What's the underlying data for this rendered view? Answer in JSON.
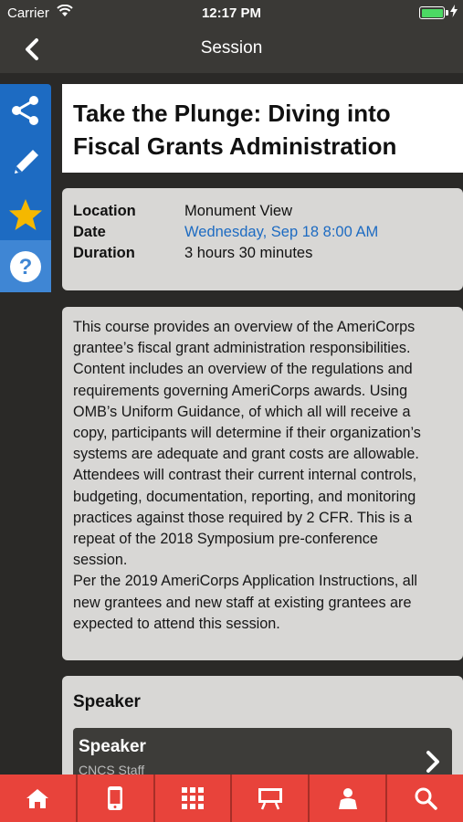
{
  "status_bar": {
    "carrier": "Carrier",
    "time": "12:17 PM",
    "battery_level": 1.0
  },
  "nav": {
    "title": "Session",
    "back_icon": "chevron-left-icon"
  },
  "side_tools": [
    {
      "icon": "share-icon"
    },
    {
      "icon": "pencil-icon"
    },
    {
      "icon": "star-icon"
    },
    {
      "icon": "help-icon"
    }
  ],
  "session": {
    "title_line1": "Take the Plunge: Diving into",
    "title_line2": "Fiscal Grants Administration",
    "location_label": "Location",
    "location_value": "Monument View",
    "date_label": "Date",
    "date_value": "Wednesday, Sep 18 8:00 AM",
    "duration_label": "Duration",
    "duration_value": "3 hours 30 minutes",
    "description_lines": [
      "This course provides an overview of the AmeriCorps",
      "grantee’s fiscal grant administration responsibilities.",
      "Content includes an overview of the regulations and",
      "requirements governing AmeriCorps awards. Using",
      "OMB’s Uniform Guidance, of which all will receive a",
      "copy, participants will determine if their organization’s",
      "systems are adequate and grant costs are allowable.",
      "Attendees will contrast their current internal controls,",
      "budgeting, documentation, reporting, and monitoring",
      "practices against those required by 2 CFR. This is a",
      "repeat of the 2018 Symposium pre-conference",
      "session.",
      "Per the 2019 AmeriCorps Application Instructions, all",
      "new grantees and new staff at existing grantees are",
      "expected to attend this session."
    ]
  },
  "speaker_section": {
    "heading": "Speaker",
    "item_name": "Speaker",
    "item_org": "CNCS Staff"
  },
  "colors": {
    "accent_blue": "#1d6bc2",
    "tab_red": "#e8433b",
    "star_yellow": "#f5b800"
  },
  "tab_bar": [
    {
      "icon": "home-icon"
    },
    {
      "icon": "mobile-icon"
    },
    {
      "icon": "grid-icon"
    },
    {
      "icon": "presentation-icon"
    },
    {
      "icon": "person-icon"
    },
    {
      "icon": "search-icon"
    }
  ]
}
